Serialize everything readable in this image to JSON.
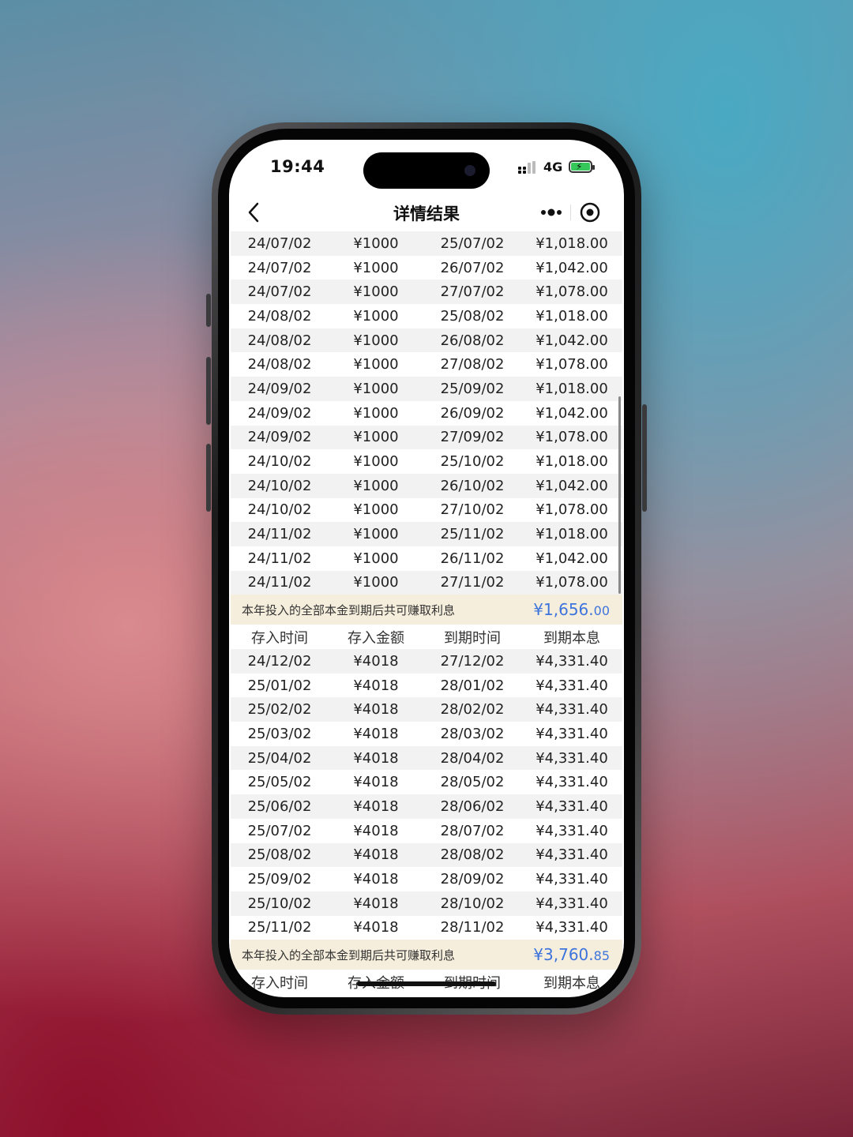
{
  "status_bar": {
    "time": "19:44",
    "network": "4G"
  },
  "navbar": {
    "title": "详情结果"
  },
  "sections": [
    {
      "rows": [
        [
          "24/07/02",
          "¥1000",
          "25/07/02",
          "¥1,018.00"
        ],
        [
          "24/07/02",
          "¥1000",
          "26/07/02",
          "¥1,042.00"
        ],
        [
          "24/07/02",
          "¥1000",
          "27/07/02",
          "¥1,078.00"
        ],
        [
          "24/08/02",
          "¥1000",
          "25/08/02",
          "¥1,018.00"
        ],
        [
          "24/08/02",
          "¥1000",
          "26/08/02",
          "¥1,042.00"
        ],
        [
          "24/08/02",
          "¥1000",
          "27/08/02",
          "¥1,078.00"
        ],
        [
          "24/09/02",
          "¥1000",
          "25/09/02",
          "¥1,018.00"
        ],
        [
          "24/09/02",
          "¥1000",
          "26/09/02",
          "¥1,042.00"
        ],
        [
          "24/09/02",
          "¥1000",
          "27/09/02",
          "¥1,078.00"
        ],
        [
          "24/10/02",
          "¥1000",
          "25/10/02",
          "¥1,018.00"
        ],
        [
          "24/10/02",
          "¥1000",
          "26/10/02",
          "¥1,042.00"
        ],
        [
          "24/10/02",
          "¥1000",
          "27/10/02",
          "¥1,078.00"
        ],
        [
          "24/11/02",
          "¥1000",
          "25/11/02",
          "¥1,018.00"
        ],
        [
          "24/11/02",
          "¥1000",
          "26/11/02",
          "¥1,042.00"
        ],
        [
          "24/11/02",
          "¥1000",
          "27/11/02",
          "¥1,078.00"
        ]
      ],
      "summary": {
        "text": "本年投入的全部本金到期后共可赚取利息",
        "value_main": "¥1,656.",
        "value_dec": "00"
      }
    },
    {
      "headers": [
        "存入时间",
        "存入金额",
        "到期时间",
        "到期本息"
      ],
      "rows": [
        [
          "24/12/02",
          "¥4018",
          "27/12/02",
          "¥4,331.40"
        ],
        [
          "25/01/02",
          "¥4018",
          "28/01/02",
          "¥4,331.40"
        ],
        [
          "25/02/02",
          "¥4018",
          "28/02/02",
          "¥4,331.40"
        ],
        [
          "25/03/02",
          "¥4018",
          "28/03/02",
          "¥4,331.40"
        ],
        [
          "25/04/02",
          "¥4018",
          "28/04/02",
          "¥4,331.40"
        ],
        [
          "25/05/02",
          "¥4018",
          "28/05/02",
          "¥4,331.40"
        ],
        [
          "25/06/02",
          "¥4018",
          "28/06/02",
          "¥4,331.40"
        ],
        [
          "25/07/02",
          "¥4018",
          "28/07/02",
          "¥4,331.40"
        ],
        [
          "25/08/02",
          "¥4018",
          "28/08/02",
          "¥4,331.40"
        ],
        [
          "25/09/02",
          "¥4018",
          "28/09/02",
          "¥4,331.40"
        ],
        [
          "25/10/02",
          "¥4018",
          "28/10/02",
          "¥4,331.40"
        ],
        [
          "25/11/02",
          "¥4018",
          "28/11/02",
          "¥4,331.40"
        ]
      ],
      "summary": {
        "text": "本年投入的全部本金到期后共可赚取利息",
        "value_main": "¥3,760.",
        "value_dec": "85"
      }
    },
    {
      "headers": [
        "存入时间",
        "存入金额",
        "到期时间",
        "到期本息"
      ],
      "rows": []
    }
  ],
  "colors": {
    "summary_bg": "#f6eedc",
    "summary_value": "#3d74dc",
    "alt_row_bg": "#f2f2f2",
    "battery": "#35c759"
  }
}
